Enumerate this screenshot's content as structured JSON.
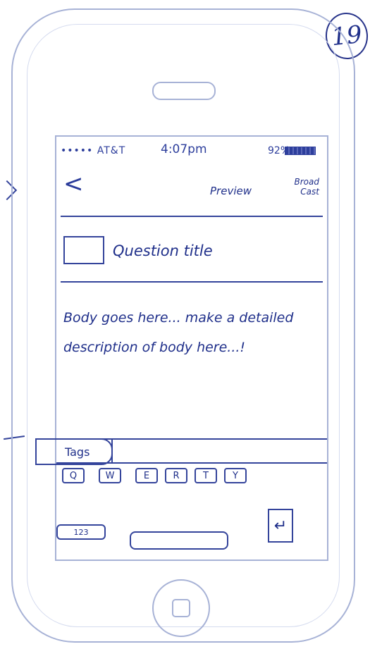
{
  "annotation": {
    "page_number": "19"
  },
  "status_bar": {
    "carrier": "••••• AT&T",
    "time": "4:07pm",
    "battery": "92%"
  },
  "nav": {
    "back_icon": "chevron-left-icon",
    "preview_label": "Preview",
    "broadcast_label": "Broad Cast"
  },
  "question": {
    "title_placeholder": "Question title",
    "body_placeholder": "Body goes here... make a detailed description of body here...!"
  },
  "tags": {
    "label": "Tags"
  },
  "keyboard": {
    "row1": [
      "Q",
      "W",
      "E",
      "R",
      "T",
      "Y"
    ],
    "numbers_key": "123",
    "return_icon": "return-icon"
  }
}
